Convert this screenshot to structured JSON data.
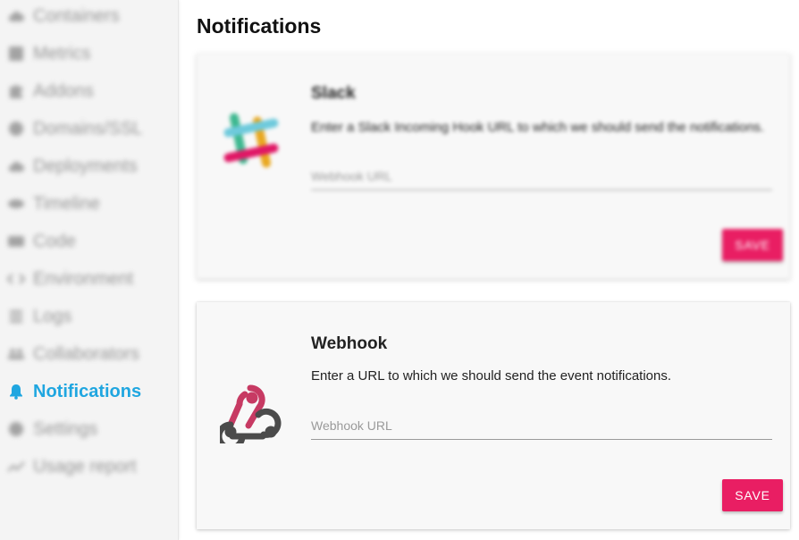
{
  "sidebar": {
    "items": [
      {
        "label": "Containers",
        "icon": "cloud-icon"
      },
      {
        "label": "Metrics",
        "icon": "metrics-icon"
      },
      {
        "label": "Addons",
        "icon": "puzzle-icon"
      },
      {
        "label": "Domains/SSL",
        "icon": "globe-icon"
      },
      {
        "label": "Deployments",
        "icon": "cloud-upload-icon"
      },
      {
        "label": "Timeline",
        "icon": "eye-icon"
      },
      {
        "label": "Code",
        "icon": "code-icon"
      },
      {
        "label": "Environment",
        "icon": "code-arrows-icon"
      },
      {
        "label": "Logs",
        "icon": "list-icon"
      },
      {
        "label": "Collaborators",
        "icon": "people-icon"
      },
      {
        "label": "Notifications",
        "icon": "bell-icon"
      },
      {
        "label": "Settings",
        "icon": "gear-icon"
      },
      {
        "label": "Usage report",
        "icon": "trending-icon"
      }
    ],
    "active_index": 10,
    "active_color": "#1fa6e0"
  },
  "main": {
    "title": "Notifications",
    "slack": {
      "title": "Slack",
      "description": "Enter a Slack Incoming Hook URL to which we should send the notifications.",
      "placeholder": "Webhook URL",
      "value": "",
      "save_label": "SAVE"
    },
    "webhook": {
      "title": "Webhook",
      "description": "Enter a URL to which we should send the event notifications.",
      "placeholder": "Webhook URL",
      "value": "",
      "save_label": "SAVE"
    }
  },
  "colors": {
    "accent": "#e91e63",
    "active": "#1fa6e0"
  }
}
